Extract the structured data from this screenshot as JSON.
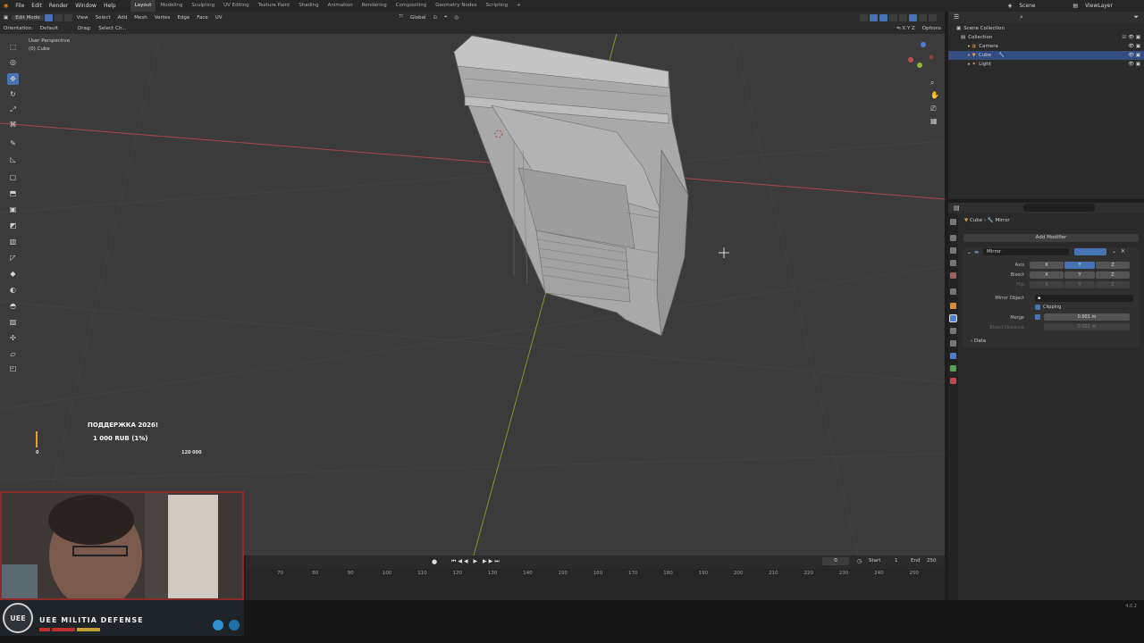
{
  "menu": {
    "items": [
      "File",
      "Edit",
      "Render",
      "Window",
      "Help"
    ],
    "workspaces": [
      "Layout",
      "Modeling",
      "Sculpting",
      "UV Editing",
      "Texture Paint",
      "Shading",
      "Animation",
      "Rendering",
      "Compositing",
      "Geometry Nodes",
      "Scripting"
    ],
    "add_tab": "+",
    "scene": "Scene",
    "view_layer": "ViewLayer"
  },
  "viewport_header": {
    "mode": "Edit Mode",
    "menus": [
      "View",
      "Select",
      "Add",
      "Mesh",
      "Vertex",
      "Edge",
      "Face",
      "UV"
    ],
    "transform_orientation": "Global",
    "options": "Options",
    "orientation_label": "Orientation:",
    "orientation_value": "Default",
    "drag_label": "Drag:",
    "drag_value": "Select Cir..."
  },
  "viewport": {
    "perspective": "User Perspective",
    "object_label": "(0) Cube"
  },
  "donation": {
    "title": "ПОДДЕРЖКА 2026!",
    "amount": "1 000 RUB (1%)",
    "min": "0",
    "max": "120 000",
    "progress": 0.01
  },
  "timeline": {
    "frame_current": "0",
    "start_label": "Start",
    "start_value": "1",
    "end_label": "End",
    "end_value": "250",
    "ticks": [
      "70",
      "80",
      "90",
      "100",
      "110",
      "120",
      "130",
      "140",
      "150",
      "160",
      "170",
      "180",
      "190",
      "200",
      "210",
      "220",
      "230",
      "240",
      "250"
    ]
  },
  "outliner": {
    "root": "Scene Collection",
    "collection": "Collection",
    "items": [
      "Camera",
      "Cube",
      "Light"
    ],
    "selected": "Cube"
  },
  "properties": {
    "breadcrumb_object": "Cube",
    "breadcrumb_modifier": "Mirror",
    "add_modifier": "Add Modifier",
    "modifier_name": "Mirror",
    "axis_label": "Axis",
    "bisect_label": "Bisect",
    "flip_label": "Flip",
    "axes": [
      "X",
      "Y",
      "Z"
    ],
    "mirror_object_label": "Mirror Object",
    "clipping_label": "Clipping",
    "merge_label": "Merge",
    "merge_value": "0.001 m",
    "bisect_distance_label": "Bisect Distance",
    "bisect_distance_value": "0.001 m",
    "data_label": "Data"
  },
  "stream": {
    "banner_text": "UEE MILITIA DEFENSE",
    "version": "4.0.2"
  },
  "colors": {
    "accent": "#4772b3",
    "viewport_bg": "#3b3b3b",
    "x_axis": "#a8454e",
    "y_axis": "#7c9a2e",
    "donation_bar": "#f0a020"
  }
}
